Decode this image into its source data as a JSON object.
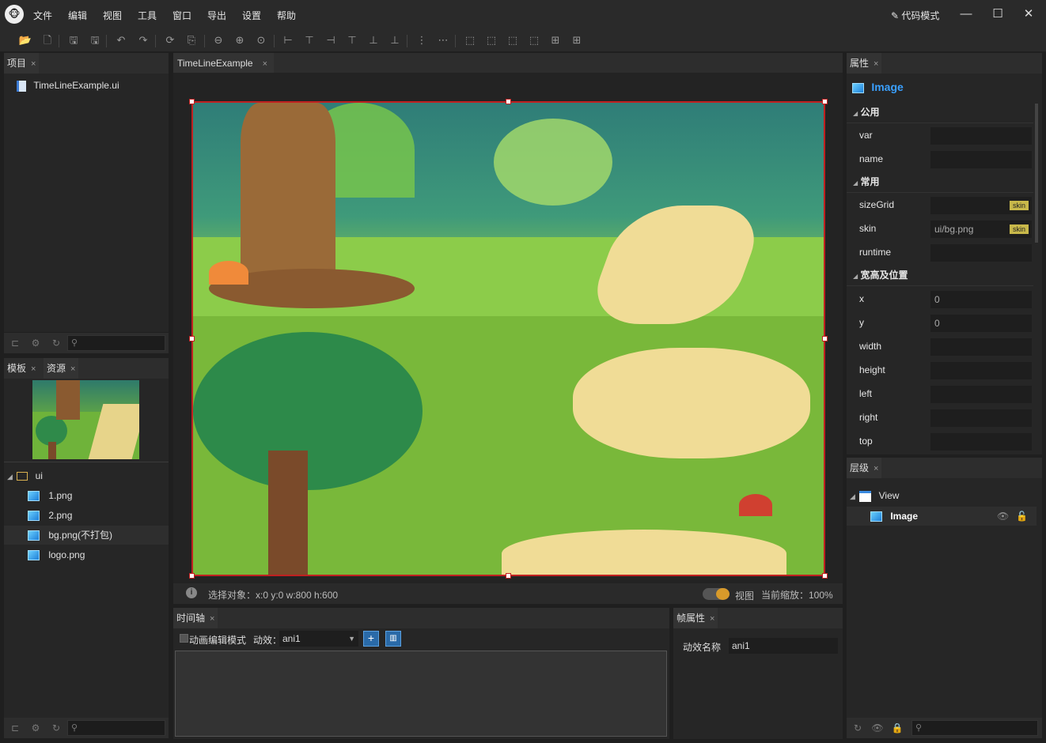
{
  "app": {
    "logo_char": "🐵"
  },
  "menu": [
    "文件",
    "编辑",
    "视图",
    "工具",
    "窗口",
    "导出",
    "设置",
    "帮助"
  ],
  "code_mode_label": "代码模式",
  "window_buttons": {
    "minimize": "—",
    "maximize": "☐",
    "close": "✕"
  },
  "project_panel": {
    "tab": "项目",
    "file": "TimeLineExample.ui"
  },
  "assets_panel": {
    "tabs": [
      "模板",
      "资源"
    ],
    "folder": "ui",
    "files": [
      "1.png",
      "2.png",
      "bg.png(不打包)",
      "logo.png"
    ]
  },
  "editor": {
    "tab": "TimeLineExample"
  },
  "status": {
    "selection": "选择对象：x:0 y:0  w:800 h:600",
    "view_label": "视图",
    "zoom": "当前缩放：100%"
  },
  "timeline": {
    "tab": "时间轴",
    "edit_mode_label": "动画编辑模式",
    "anim_label": "动效：",
    "anim_value": "ani1"
  },
  "frame_props": {
    "tab": "帧属性",
    "name_label": "动效名称",
    "name_value": "ani1"
  },
  "properties": {
    "tab": "属性",
    "component": "Image",
    "sections": {
      "common": "公用",
      "normal": "常用",
      "size_pos": "宽高及位置"
    },
    "labels": {
      "var": "var",
      "name": "name",
      "sizeGrid": "sizeGrid",
      "skin": "skin",
      "runtime": "runtime",
      "x": "x",
      "y": "y",
      "width": "width",
      "height": "height",
      "left": "left",
      "right": "right",
      "top": "top"
    },
    "values": {
      "skin": "ui/bg.png",
      "x": "0",
      "y": "0"
    },
    "skin_tag": "skin"
  },
  "layers": {
    "tab": "层级",
    "root": "View",
    "child": "Image"
  },
  "colors": {
    "accent": "#3aa0ff",
    "selection_border": "#c02020",
    "toggle": "#d89a2a"
  }
}
